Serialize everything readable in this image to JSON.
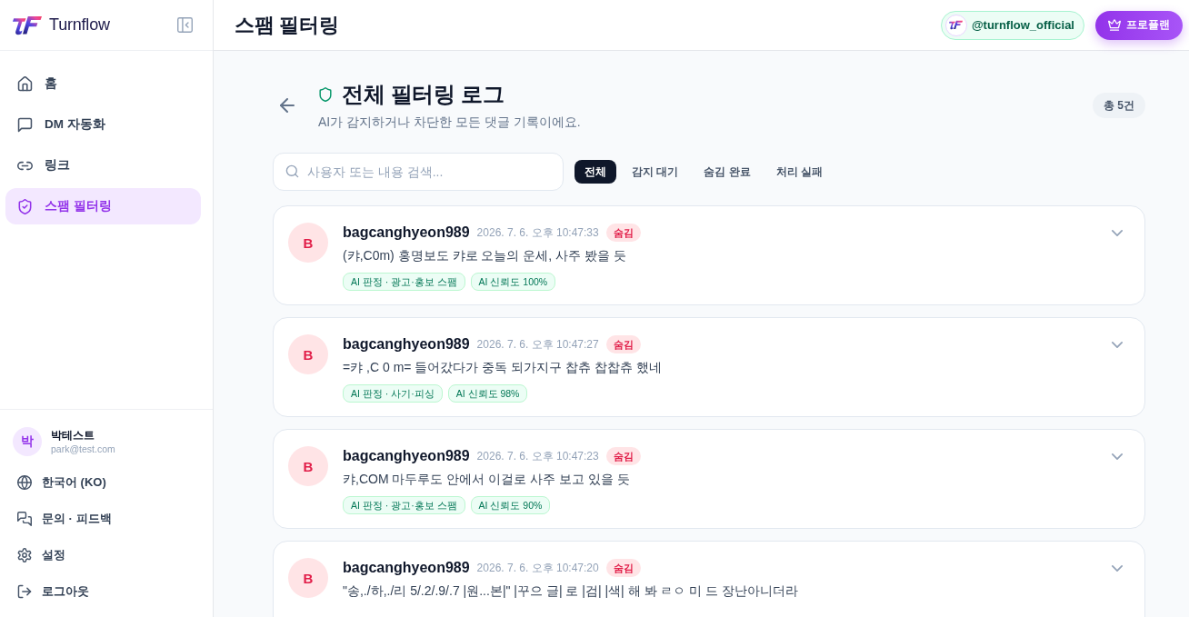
{
  "sidebar": {
    "brand": "Turnflow",
    "nav": [
      {
        "label": "홈",
        "selected": false
      },
      {
        "label": "DM 자동화",
        "selected": false
      },
      {
        "label": "링크",
        "selected": false
      },
      {
        "label": "스팸 필터링",
        "selected": true
      }
    ],
    "user": {
      "initial": "박",
      "name": "박테스트",
      "email": "park@test.com"
    },
    "footer_items": [
      "한국어 (KO)",
      "문의 · 피드백",
      "설정",
      "로그아웃"
    ]
  },
  "header": {
    "title": "스팸 필터링",
    "account": "@turnflow_official",
    "plan_button": "프로플랜"
  },
  "page": {
    "title": "전체 필터링 로그",
    "subtitle": "AI가 감지하거나 차단한 모든 댓글 기록이에요.",
    "total": "총 5건"
  },
  "search": {
    "placeholder": "사용자 또는 내용 검색..."
  },
  "filters": [
    {
      "label": "전체",
      "selected": true
    },
    {
      "label": "감지 대기",
      "selected": false
    },
    {
      "label": "숨김 완료",
      "selected": false
    },
    {
      "label": "처리 실패",
      "selected": false
    }
  ],
  "comments": [
    {
      "initial": "B",
      "user": "bagcanghyeon989",
      "time": "2026. 7. 6. 오후 10:47:33",
      "status": "숨김",
      "text": "(캬,C0m) 홍명보도 캬로 오늘의 운세, 사주 봤을 듯",
      "tags": [
        "AI 판정 · 광고·홍보 스팸",
        "AI 신뢰도 100%"
      ]
    },
    {
      "initial": "B",
      "user": "bagcanghyeon989",
      "time": "2026. 7. 6. 오후 10:47:27",
      "status": "숨김",
      "text": "=캬 ,C 0 m= 들어갔다가 중독 되가지구 찹츄 찹찹츄 했네",
      "tags": [
        "AI 판정 · 사기·피싱",
        "AI 신뢰도 98%"
      ]
    },
    {
      "initial": "B",
      "user": "bagcanghyeon989",
      "time": "2026. 7. 6. 오후 10:47:23",
      "status": "숨김",
      "text": "캬,COM 마두루도 안에서 이걸로 사주 보고 있을 듯",
      "tags": [
        "AI 판정 · 광고·홍보 스팸",
        "AI 신뢰도 90%"
      ]
    },
    {
      "initial": "B",
      "user": "bagcanghyeon989",
      "time": "2026. 7. 6. 오후 10:47:20",
      "status": "숨김",
      "text": "\"송,./하,./리 5/.2/.9/.7 |원...본|\" |꾸으 글| 로 |검| |색| 해 봐 ㄹㅇ 미 드 장난아니더라"
    }
  ]
}
